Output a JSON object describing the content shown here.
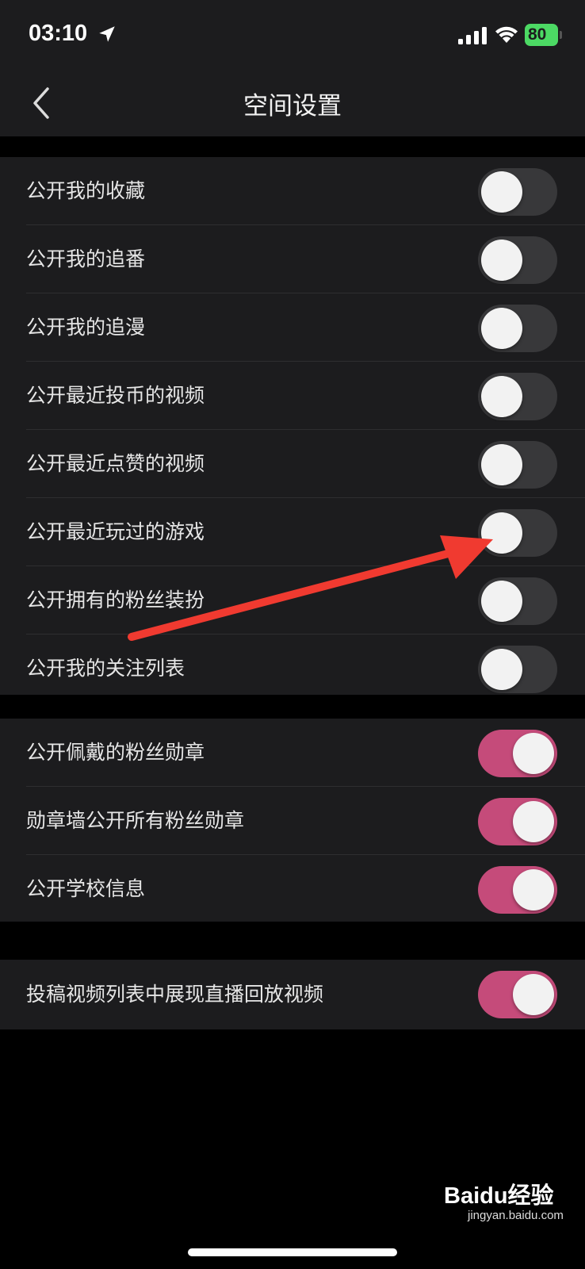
{
  "status_bar": {
    "time": "03:10",
    "battery": "80",
    "icons": [
      "location-arrow-icon",
      "signal-icon",
      "wifi-icon",
      "battery-charging-icon"
    ],
    "battery_color": "#4cd964"
  },
  "nav": {
    "title": "空间设置",
    "back_icon": "chevron-left-icon"
  },
  "colors": {
    "background": "#000000",
    "panel": "#1c1c1e",
    "toggle_on": "#c54b7a",
    "toggle_off": "#38383a",
    "annotation_arrow": "#f03a30"
  },
  "groups": [
    {
      "items": [
        {
          "label": "公开我的收藏",
          "on": false
        },
        {
          "label": "公开我的追番",
          "on": false
        },
        {
          "label": "公开我的追漫",
          "on": false
        },
        {
          "label": "公开最近投币的视频",
          "on": false
        },
        {
          "label": "公开最近点赞的视频",
          "on": false
        },
        {
          "label": "公开最近玩过的游戏",
          "on": false
        },
        {
          "label": "公开拥有的粉丝装扮",
          "on": false
        },
        {
          "label": "公开我的关注列表",
          "on": false
        }
      ]
    },
    {
      "items": [
        {
          "label": "公开佩戴的粉丝勋章",
          "on": true
        },
        {
          "label": "勋章墙公开所有粉丝勋章",
          "on": true
        },
        {
          "label": "公开学校信息",
          "on": true
        }
      ]
    },
    {
      "items": [
        {
          "label": "投稿视频列表中展现直播回放视频",
          "on": true
        }
      ]
    }
  ],
  "watermark": {
    "text": "Baidu经验",
    "sub": "jingyan.baidu.com"
  }
}
